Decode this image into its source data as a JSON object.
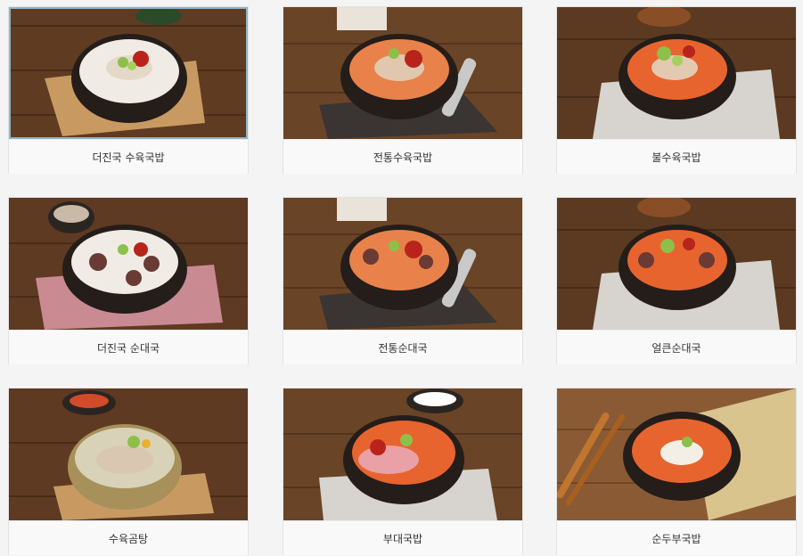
{
  "colors": {
    "background": "#f4f4f4",
    "card": "#ffffff",
    "active_border": "#8fb4c4",
    "wood": "#6b4326",
    "bowl": "#2a2320",
    "milky_broth": "#f1ede6",
    "red_broth": "#e8642e",
    "chili": "#b8241c",
    "scallion": "#8cc04a"
  },
  "menu": {
    "items": [
      {
        "label": "더진국 수육국밥",
        "broth": "milky",
        "active": true
      },
      {
        "label": "전통수육국밥",
        "broth": "orange"
      },
      {
        "label": "불수육국밥",
        "broth": "red"
      },
      {
        "label": "더진국 순대국",
        "broth": "milky"
      },
      {
        "label": "전통순대국",
        "broth": "orange"
      },
      {
        "label": "얼큰순대국",
        "broth": "red"
      },
      {
        "label": "수육곰탕",
        "broth": "clear"
      },
      {
        "label": "부대국밥",
        "broth": "red"
      },
      {
        "label": "순두부국밥",
        "broth": "red"
      }
    ]
  }
}
